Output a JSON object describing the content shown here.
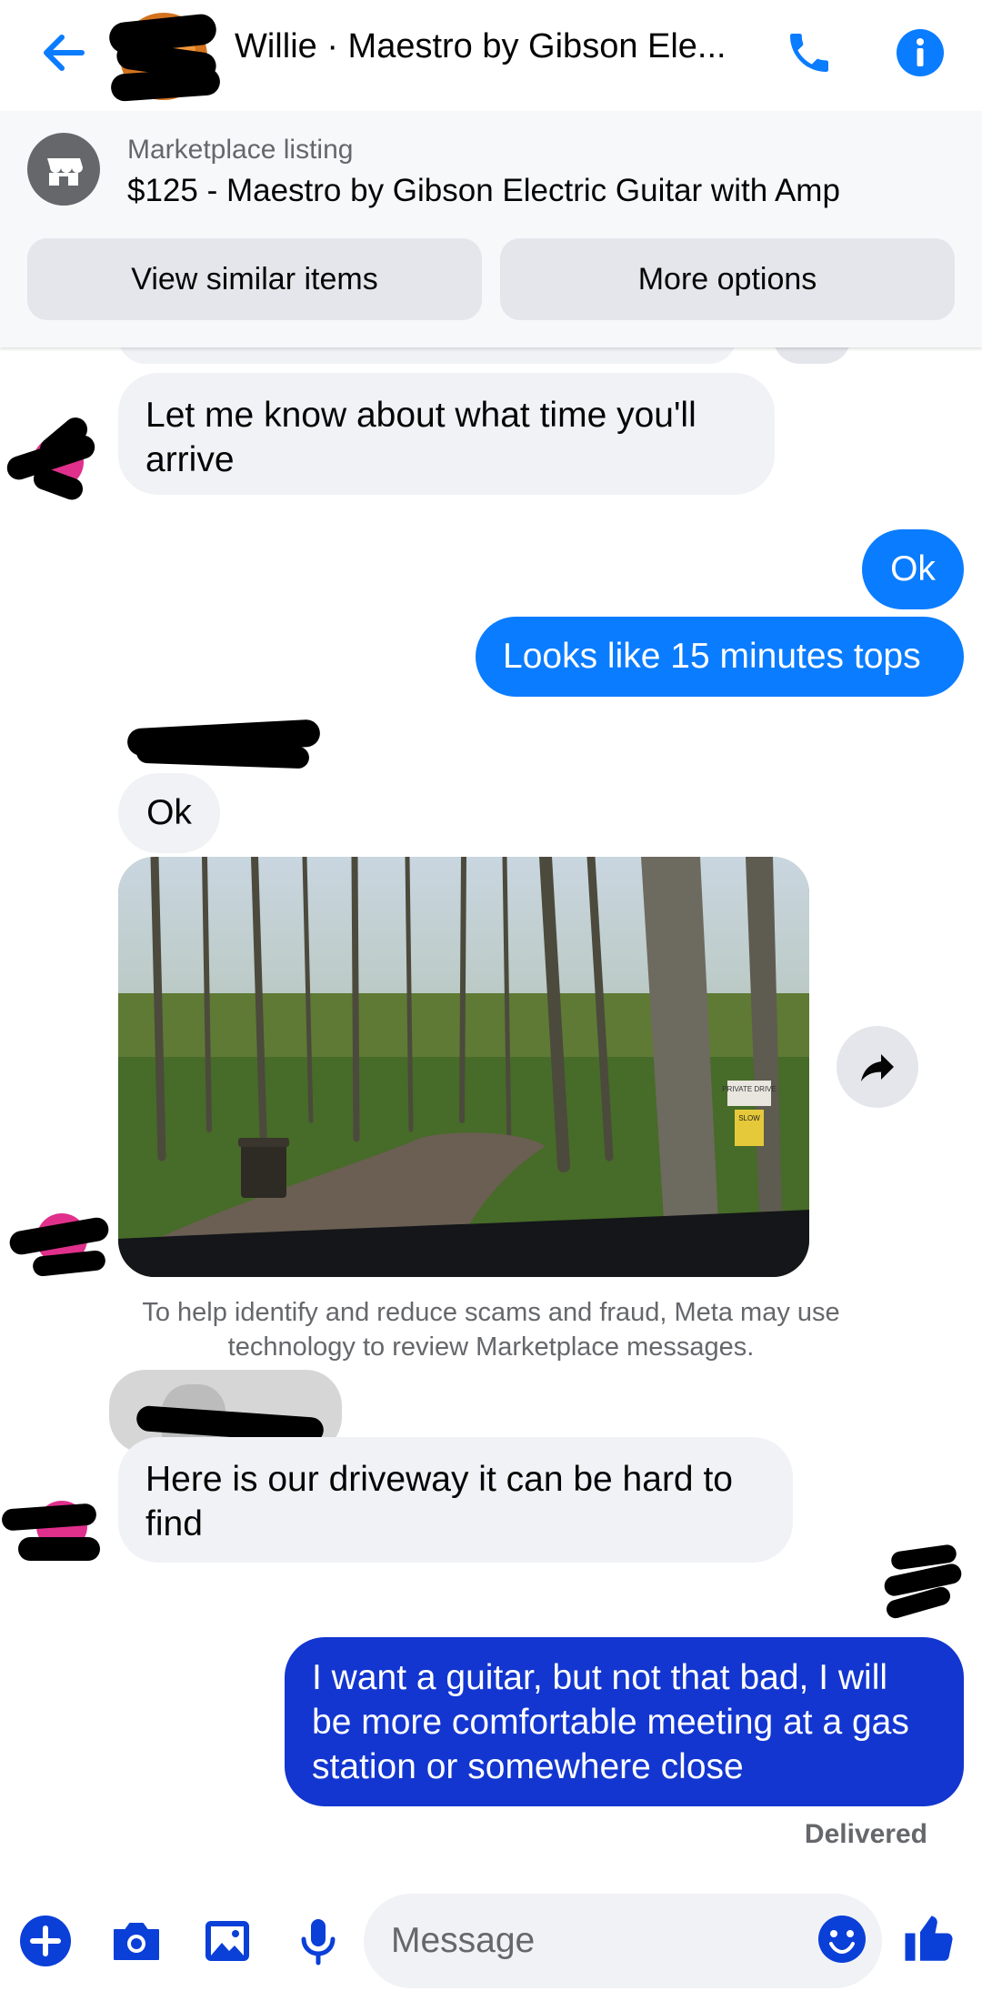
{
  "header": {
    "title": "Willie · Maestro by Gibson Ele...",
    "icons": [
      "back-arrow-icon",
      "phone-icon",
      "info-icon"
    ],
    "accent_color": "#0a7cff"
  },
  "listing": {
    "label": "Marketplace listing",
    "item": "$125 - Maestro by Gibson Electric Guitar with Amp",
    "buttons": [
      "View similar items",
      "More options"
    ]
  },
  "messages": {
    "m1": "Let me know about what time you'll arrive",
    "m2": "Ok",
    "m3": "Looks like 15 minutes tops",
    "m4": "Ok",
    "m6": "Here is our driveway it can be hard to find",
    "m7": "I want a guitar, but not that bad, I will be more comfortable meeting at a gas station or somewhere close"
  },
  "photo": {
    "sign_top": "PRIVATE DRIVE",
    "sign_bottom": "SLOW"
  },
  "notice": "To help identify and reduce scams and fraud, Meta may use technology to review Marketplace messages.",
  "status": "Delivered",
  "composer": {
    "placeholder": "Message",
    "icons": [
      "plus-icon",
      "camera-icon",
      "gallery-icon",
      "microphone-icon",
      "emoji-icon",
      "thumbs-up-icon"
    ]
  },
  "colors": {
    "incoming_bubble": "#f0f2f5",
    "outgoing_bubble": "#0a7cff",
    "outgoing_bubble_latest": "#1336d0",
    "composer_icons": "#0a3fd8"
  }
}
